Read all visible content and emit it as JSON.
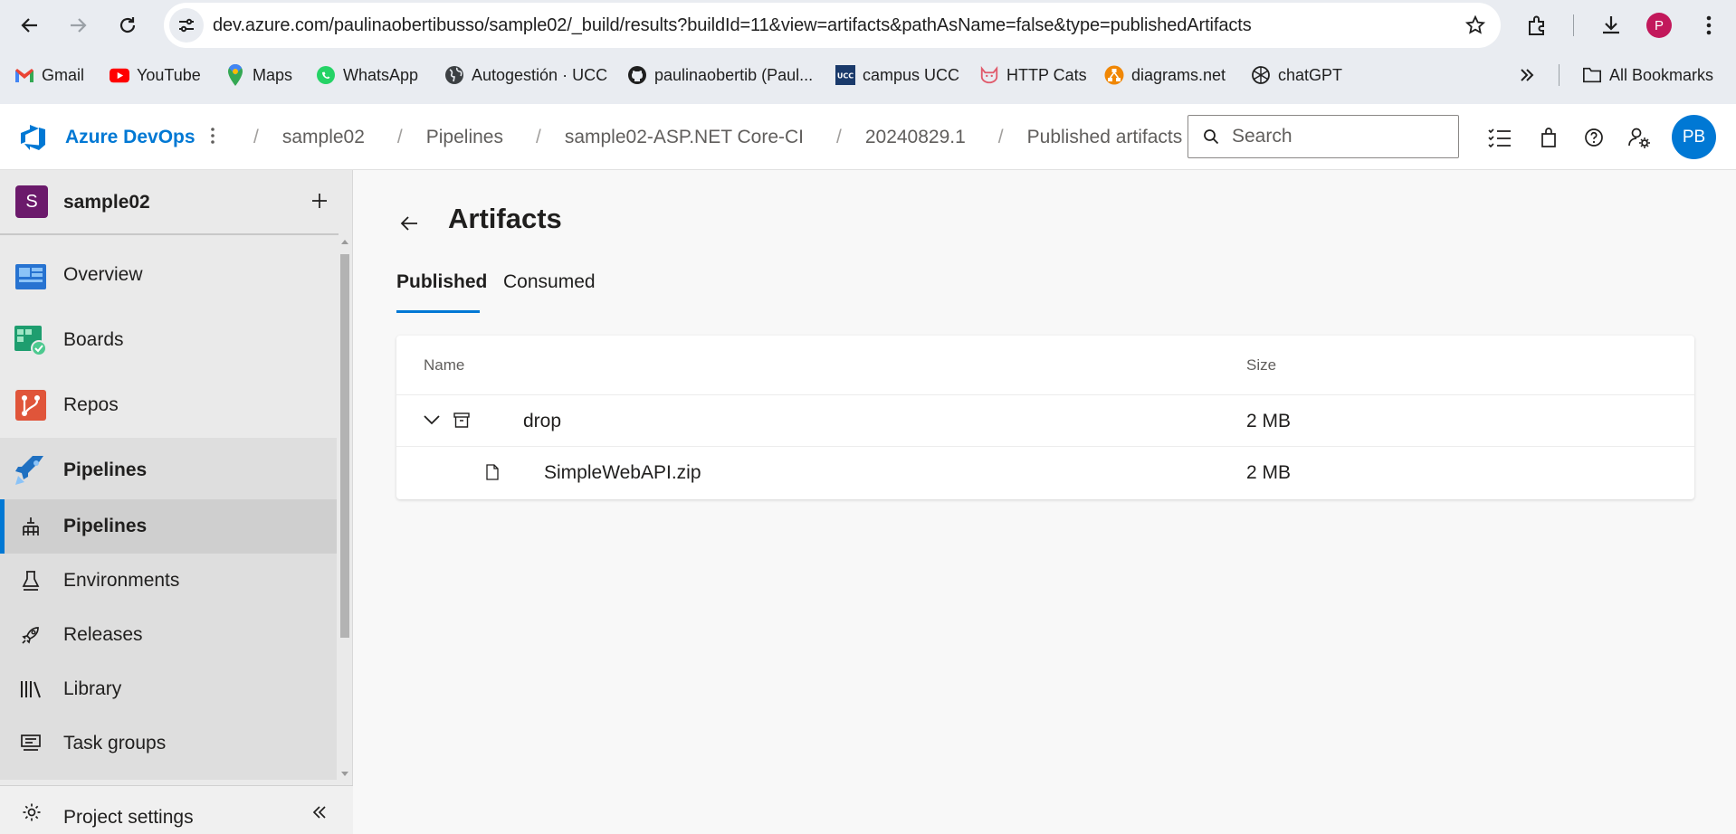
{
  "browser": {
    "url": "dev.azure.com/paulinaobertibusso/sample02/_build/results?buildId=11&view=artifacts&pathAsName=false&type=publishedArtifacts",
    "profile_initial": "P",
    "bookmarks": [
      {
        "label": "Gmail",
        "icon": "gmail-icon"
      },
      {
        "label": "YouTube",
        "icon": "youtube-icon"
      },
      {
        "label": "Maps",
        "icon": "maps-icon"
      },
      {
        "label": "WhatsApp",
        "icon": "whatsapp-icon"
      },
      {
        "label": "Autogestión · UCC",
        "icon": "globe-icon"
      },
      {
        "label": "paulinaobertib (Paul...",
        "icon": "github-icon"
      },
      {
        "label": "campus UCC",
        "icon": "ucc-icon"
      },
      {
        "label": "HTTP Cats",
        "icon": "cat-icon"
      },
      {
        "label": "diagrams.net",
        "icon": "diagrams-icon"
      },
      {
        "label": "chatGPT",
        "icon": "openai-icon"
      }
    ],
    "all_bookmarks_label": "All Bookmarks"
  },
  "header": {
    "brand": "Azure DevOps",
    "breadcrumbs": [
      "sample02",
      "Pipelines",
      "sample02-ASP.NET Core-CI",
      "20240829.1",
      "Published artifacts"
    ],
    "search_placeholder": "Search",
    "avatar_initials": "PB"
  },
  "sidebar": {
    "project_initial": "S",
    "project_name": "sample02",
    "items": [
      {
        "label": "Overview"
      },
      {
        "label": "Boards"
      },
      {
        "label": "Repos"
      },
      {
        "label": "Pipelines"
      }
    ],
    "sub_items": [
      {
        "label": "Pipelines"
      },
      {
        "label": "Environments"
      },
      {
        "label": "Releases"
      },
      {
        "label": "Library"
      },
      {
        "label": "Task groups"
      }
    ],
    "project_settings": "Project settings"
  },
  "main": {
    "title": "Artifacts",
    "tabs": [
      {
        "label": "Published",
        "active": true
      },
      {
        "label": "Consumed",
        "active": false
      }
    ],
    "table": {
      "columns": [
        "Name",
        "Size"
      ],
      "rows": [
        {
          "name": "drop",
          "size": "2 MB",
          "type": "folder",
          "expanded": true
        },
        {
          "name": "SimpleWebAPI.zip",
          "size": "2 MB",
          "type": "file"
        }
      ]
    }
  },
  "colors": {
    "accent": "#0078d4",
    "project_badge": "#6b1a6b"
  }
}
